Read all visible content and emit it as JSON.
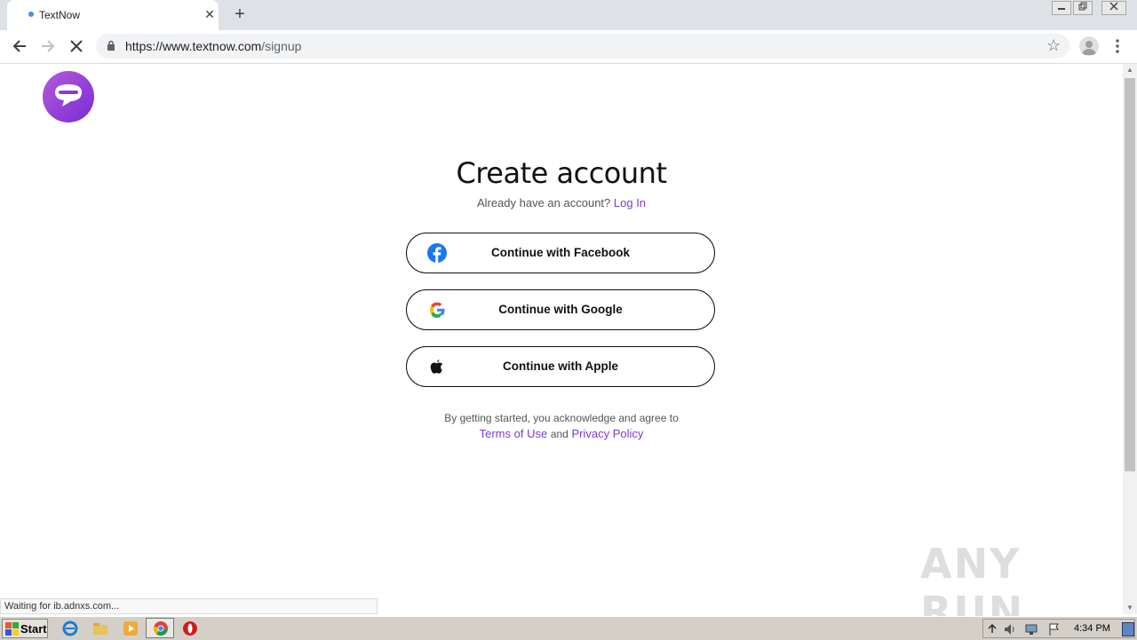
{
  "browser": {
    "tab_title": "TextNow",
    "new_tab_symbol": "+",
    "close_symbol": "✕",
    "url_host": "https://www.textnow.com",
    "url_path": "/signup",
    "bookmark_symbol": "☆"
  },
  "page": {
    "title": "Create account",
    "already_text": "Already have an account?",
    "login_link": "Log In",
    "buttons": {
      "facebook": "Continue with Facebook",
      "google": "Continue with Google",
      "apple": "Continue with Apple"
    },
    "legal_line1": "By getting started, you acknowledge and agree to",
    "terms_link": "Terms of Use",
    "and_text": "and",
    "privacy_link": "Privacy Policy"
  },
  "status_text": "Waiting for ib.adnxs.com...",
  "watermark": "ANY RUN",
  "taskbar": {
    "start_label": "Start",
    "clock": "4:34 PM"
  },
  "colors": {
    "accent": "#7e3bd0",
    "facebook": "#1877f2"
  }
}
